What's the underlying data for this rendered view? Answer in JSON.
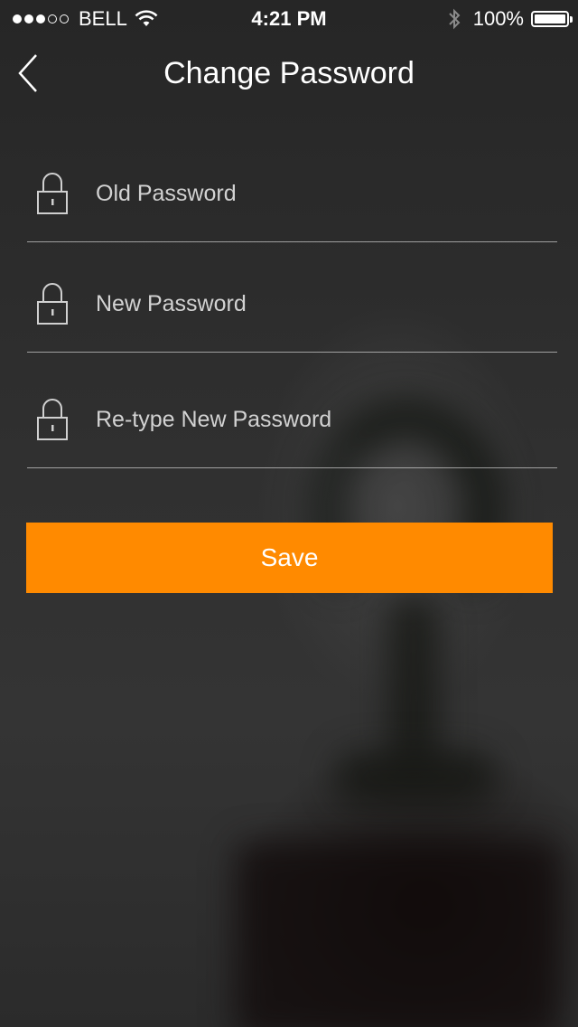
{
  "status_bar": {
    "signal_full": 3,
    "signal_total": 5,
    "carrier": "BELL",
    "time": "4:21 PM",
    "battery_percent": "100%",
    "wifi_icon": "wifi-icon",
    "bluetooth_icon": "bluetooth-icon",
    "battery_level": 1.0
  },
  "nav": {
    "title": "Change Password",
    "back_icon": "chevron-left-icon"
  },
  "form": {
    "fields": [
      {
        "placeholder": "Old Password",
        "value": "",
        "icon": "lock-icon"
      },
      {
        "placeholder": "New Password",
        "value": "",
        "icon": "lock-icon"
      },
      {
        "placeholder": "Re-type New Password",
        "value": "",
        "icon": "lock-icon"
      }
    ],
    "save_label": "Save"
  },
  "colors": {
    "accent": "#ff8a00",
    "text": "#ffffff",
    "divider": "#8c8c8c",
    "background": "#2e2e2e"
  }
}
